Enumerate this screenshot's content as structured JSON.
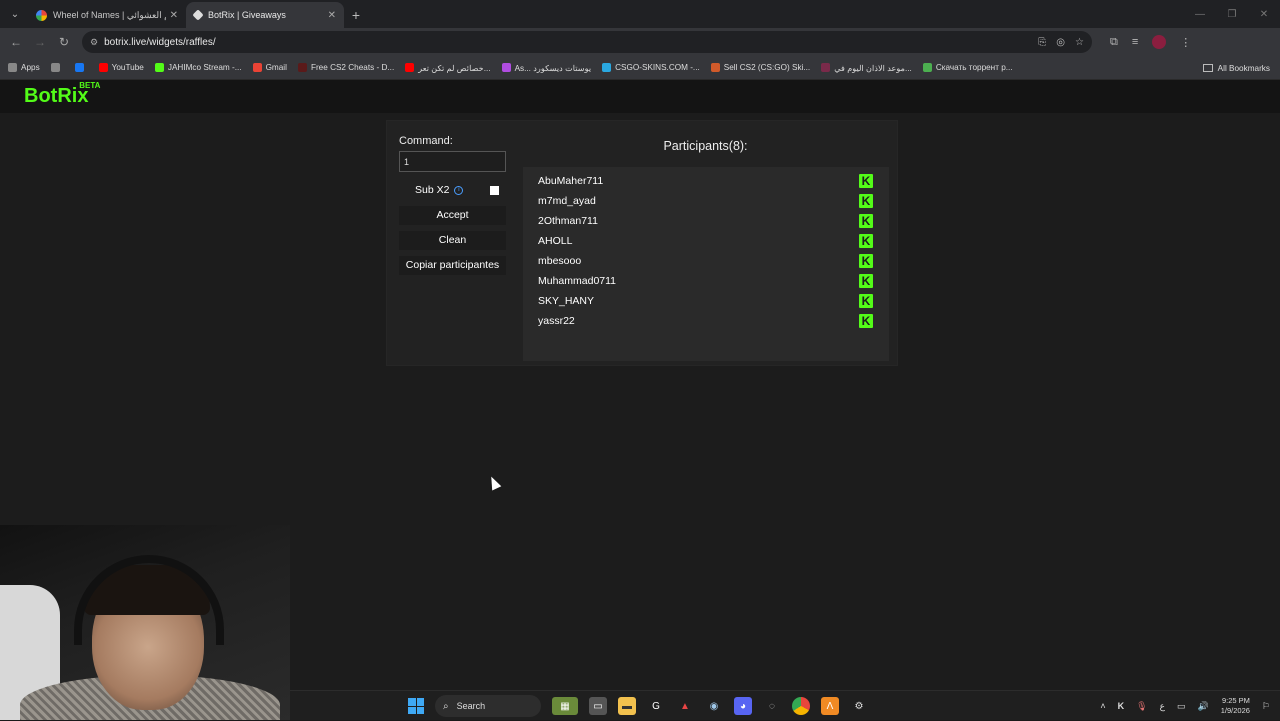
{
  "browser": {
    "tabs": [
      {
        "title": "Wheel of Names | سم العشوائي",
        "active": false,
        "color": "#e8453c"
      },
      {
        "title": "BotRix | Giveaways",
        "active": true,
        "color": "#cccccc"
      }
    ],
    "url": "botrix.live/widgets/raffles/",
    "bookmarks": [
      {
        "label": "Apps",
        "color": "#888888"
      },
      {
        "label": "",
        "color": "#888888"
      },
      {
        "label": "",
        "color": "#1877f2"
      },
      {
        "label": "YouTube",
        "color": "#ff0000"
      },
      {
        "label": "JAHIMco Stream -...",
        "color": "#53fc18"
      },
      {
        "label": "Gmail",
        "color": "#ea4335"
      },
      {
        "label": "Free CS2 Cheats - D...",
        "color": "#5a1a1a"
      },
      {
        "label": "خصائص لم تكن تعر...",
        "color": "#ff0000"
      },
      {
        "label": "As... يوستات ديسكورد",
        "color": "#b04de0"
      },
      {
        "label": "CSGO-SKINS.COM -...",
        "color": "#2aa8e0"
      },
      {
        "label": "Sell CS2 (CS:GO) Ski...",
        "color": "#d05a2a"
      },
      {
        "label": "موعد الاذان اليوم في...",
        "color": "#7a2a4a"
      },
      {
        "label": "Скачать торрент р...",
        "color": "#4caf50"
      }
    ],
    "all_bookmarks": "All Bookmarks"
  },
  "site": {
    "logo": "BotRix",
    "logo_badge": "BETA"
  },
  "raffle": {
    "command_label": "Command:",
    "command_value": "1",
    "sub_label": "Sub X2",
    "accept_label": "Accept",
    "clean_label": "Clean",
    "copy_label": "Copiar participantes",
    "participants_title": "Participants(8):",
    "participants": [
      "AbuMaher711",
      "m7md_ayad",
      "2Othman711",
      "AHOLL",
      "mbesooo",
      "Muhammad0711",
      "SKY_HANY",
      "yassr22"
    ],
    "platform_icon": "kick-icon",
    "accent_color": "#53fc18"
  },
  "taskbar": {
    "search_placeholder": "Search",
    "time": "9:25 PM",
    "date": "1/9/2026",
    "lang": "ع"
  }
}
